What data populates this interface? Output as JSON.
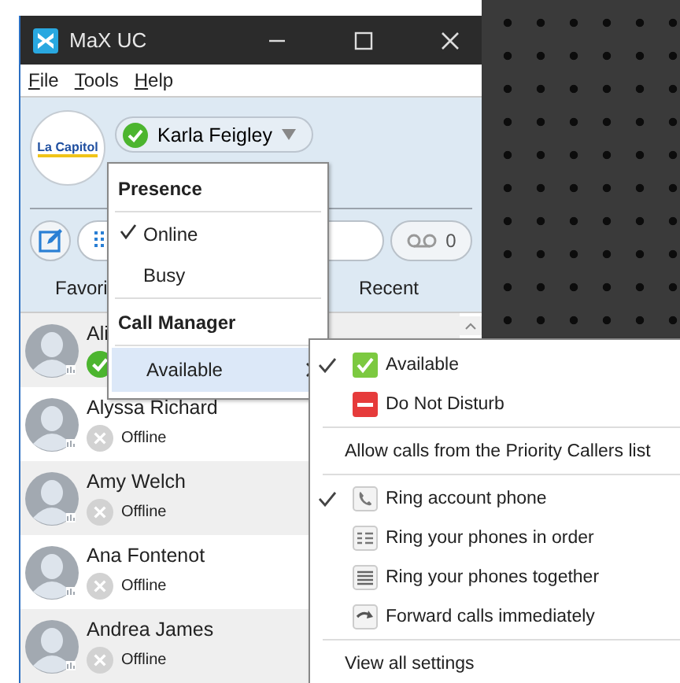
{
  "window": {
    "title": "MaX UC"
  },
  "menu_bar": [
    "File",
    "Tools",
    "Help"
  ],
  "profile": {
    "logo_text": "La Capitol",
    "name": "Karla Feigley",
    "online": true
  },
  "toolbar": {
    "voicemail_count": "0"
  },
  "tabs": [
    {
      "label": "Favori",
      "selected": false
    },
    {
      "label": "Recent",
      "selected": false
    }
  ],
  "contacts": [
    {
      "name": "Ali",
      "online": true
    },
    {
      "name": "Alyssa Richard",
      "online": false,
      "status_text": "Offline"
    },
    {
      "name": "Amy Welch",
      "online": false,
      "status_text": "Offline"
    },
    {
      "name": "Ana Fontenot",
      "online": false,
      "status_text": "Offline"
    },
    {
      "name": "Andrea James",
      "online": false,
      "status_text": "Offline"
    }
  ],
  "presence_menu": {
    "sections": [
      {
        "heading": "Presence",
        "items": [
          {
            "label": "Online",
            "checked": true,
            "highlighted": false,
            "has_submenu": false
          },
          {
            "label": "Busy",
            "checked": false,
            "highlighted": false,
            "has_submenu": false
          }
        ]
      },
      {
        "heading": "Call Manager",
        "items": [
          {
            "label": "Available",
            "checked": false,
            "highlighted": true,
            "has_submenu": true
          }
        ]
      }
    ]
  },
  "submenu": {
    "groups": [
      [
        {
          "label": "Available",
          "kind": "available",
          "checked": true
        },
        {
          "label": "Do Not Disturb",
          "kind": "dnd",
          "checked": false
        }
      ],
      [
        {
          "label": "Allow calls from the Priority Callers list",
          "kind": "text",
          "checked": false
        }
      ],
      [
        {
          "label": "Ring account phone",
          "kind": "phone",
          "checked": true
        },
        {
          "label": "Ring your phones in order",
          "kind": "order",
          "checked": false
        },
        {
          "label": "Ring your phones together",
          "kind": "together",
          "checked": false
        },
        {
          "label": "Forward calls immediately",
          "kind": "forward",
          "checked": false
        }
      ],
      [
        {
          "label": "View all settings",
          "kind": "text",
          "checked": false
        }
      ]
    ]
  }
}
